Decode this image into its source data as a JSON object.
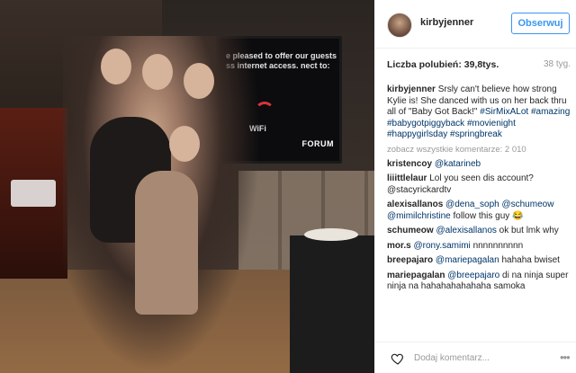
{
  "photo": {
    "tv_text": "e pleased to offer our guests ss internet access. nect to:",
    "wifi_label": "WiFi",
    "forum_logo": "FORUM"
  },
  "header": {
    "username": "kirbyjenner",
    "follow_label": "Obserwuj"
  },
  "stats": {
    "likes": "Liczba polubień: 39,8tys.",
    "time_ago": "38 tyg."
  },
  "caption": {
    "user": "kirbyjenner",
    "text": "Srsly can't believe how strong Kylie is! She danced with us on her back thru all of \"Baby Got Back!\"",
    "hashtags": "#SirMixALot #amazing #babygotpiggyback #movienight #happygirlsday #springbreak"
  },
  "load_more": "zobacz wszystkie komentarze: 2 010",
  "comments": [
    {
      "user": "kristencoy",
      "mention": "@katarineb",
      "text": ""
    },
    {
      "user": "liiittlelaur",
      "mention": "",
      "text": "Lol you seen dis account? @stacyrickardtv"
    },
    {
      "user": "alexisallanos",
      "mention": "@dena_soph @schumeow @mimilchristine",
      "text": "follow this guy 😂"
    },
    {
      "user": "schumeow",
      "mention": "@alexisallanos",
      "text": "ok but lmk why"
    },
    {
      "user": "mor.s",
      "mention": "@rony.samimi",
      "text": "nnnnnnnnnn"
    },
    {
      "user": "breepajaro",
      "mention": "@mariepagalan",
      "text": "hahaha bwiset"
    },
    {
      "user": "mariepagalan",
      "mention": "@breepajaro",
      "text": "di na ninja super ninja na hahahahahahaha samoka"
    }
  ],
  "footer": {
    "add_comment_placeholder": "Dodaj komentarz...",
    "more_label": "•••"
  },
  "colors": {
    "accent": "#3897f0",
    "link": "#003569",
    "muted": "#999999"
  }
}
